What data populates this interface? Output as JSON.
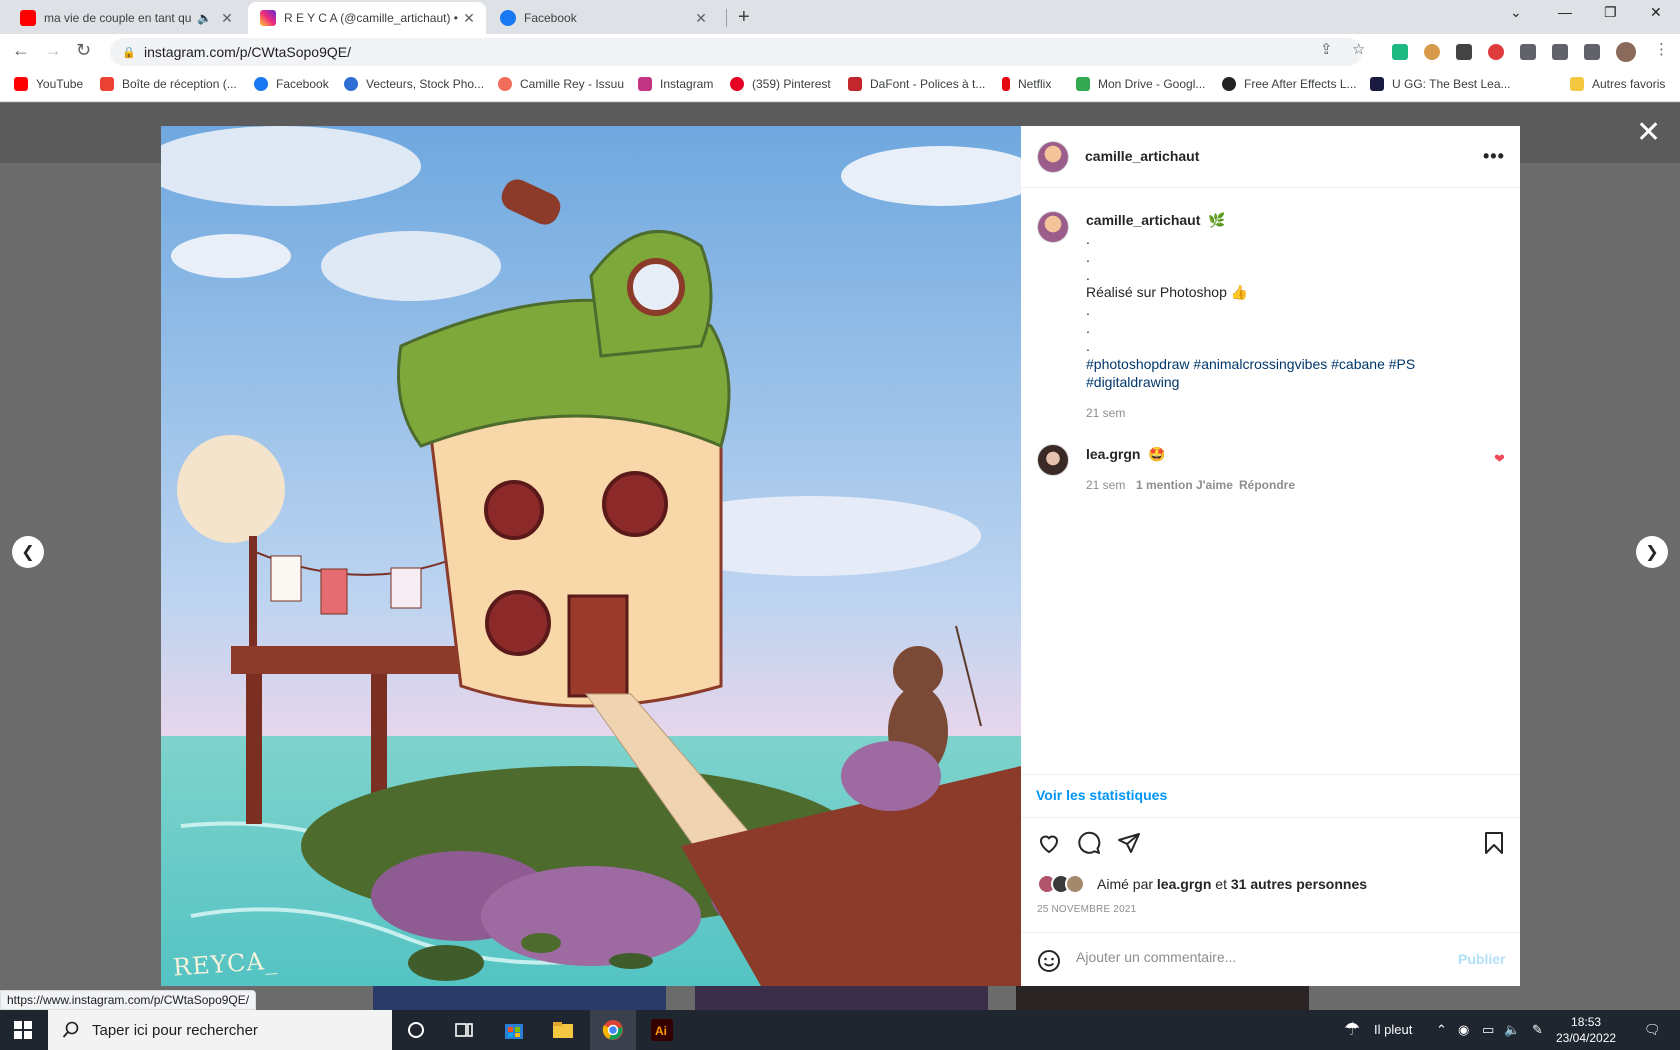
{
  "tabs": [
    {
      "title": "ma vie de couple en tant qu",
      "audio": "🔈",
      "close": "✕"
    },
    {
      "title": "R E Y C A (@camille_artichaut) • I",
      "close": "✕"
    },
    {
      "title": "Facebook",
      "close": "✕"
    }
  ],
  "new_tab": "+",
  "window_controls": [
    "⌄",
    "—",
    "❐",
    "✕"
  ],
  "toolbar": {
    "url": "instagram.com/p/CWtaSopo9QE/"
  },
  "bookmarks": [
    {
      "label": "YouTube",
      "color": "#ff0000"
    },
    {
      "label": "Boîte de réception (...",
      "color": "#ea4335"
    },
    {
      "label": "Facebook",
      "color": "#1877f2"
    },
    {
      "label": "Vecteurs, Stock Pho...",
      "color": "#2f6fd6"
    },
    {
      "label": "Camille Rey - Issuu",
      "color": "#f36d5d"
    },
    {
      "label": "Instagram",
      "color": "#c13584"
    },
    {
      "label": "(359) Pinterest",
      "color": "#e60023"
    },
    {
      "label": "DaFont - Polices à t...",
      "color": "#c1272d"
    },
    {
      "label": "Netflix",
      "color": "#e50914"
    },
    {
      "label": "Mon Drive - Googl...",
      "color": "#34a853"
    },
    {
      "label": "Free After Effects L...",
      "color": "#222222"
    },
    {
      "label": "U GG: The Best Lea...",
      "color": "#1a1a40"
    },
    {
      "label": "Autres favoris",
      "color": "#f5c842"
    }
  ],
  "post": {
    "author": "camille_artichaut",
    "more": "•••",
    "caption_author": "camille_artichaut",
    "caption_emoji": "🌿",
    "caption_lines": [
      ".",
      ".",
      ".",
      "Réalisé sur Photoshop 👍",
      ".",
      ".",
      "."
    ],
    "hashtags": "#photoshopdraw #animalcrossingvibes #cabane #PS #digitaldrawing",
    "caption_time": "21 sem",
    "comment": {
      "user": "lea.grgn",
      "text": "🤩",
      "time": "21 sem",
      "likes": "1 mention J'aime",
      "reply": "Répondre"
    },
    "stats_link": "Voir les statistiques",
    "liked_by_prefix": "Aimé par",
    "liked_by_user": "lea.grgn",
    "liked_by_mid": "et",
    "liked_by_others": "31 autres personnes",
    "date": "25 NOVEMBRE 2021",
    "comment_placeholder": "Ajouter un commentaire...",
    "publish": "Publier",
    "signature": "REYCA_"
  },
  "status_url": "https://www.instagram.com/p/CWtaSopo9QE/",
  "taskbar": {
    "search_placeholder": "Taper ici pour rechercher",
    "weather": "Il pleut",
    "time": "18:53",
    "date": "23/04/2022"
  },
  "colors": {
    "accent": "#0095f6",
    "heart": "#ed4956",
    "link": "#00376b"
  }
}
